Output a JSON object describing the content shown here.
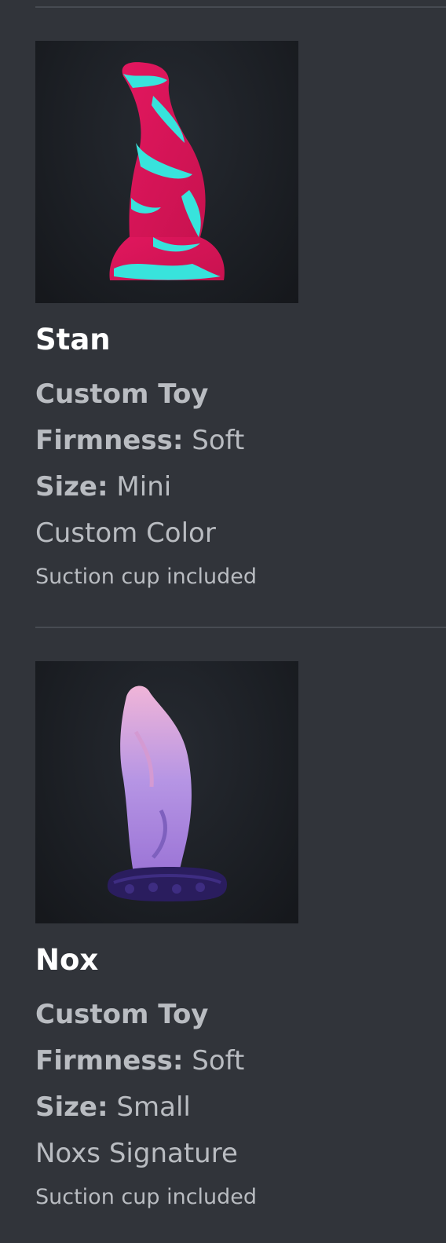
{
  "products": [
    {
      "name": "Stan",
      "type": "Custom Toy",
      "firmness_label": "Firmness:",
      "firmness": "Soft",
      "size_label": "Size:",
      "size": "Mini",
      "color": "Custom Color",
      "extra": "Suction cup included",
      "image_colors": [
        "#e3175f",
        "#38e3dc"
      ]
    },
    {
      "name": "Nox",
      "type": "Custom Toy",
      "firmness_label": "Firmness:",
      "firmness": "Soft",
      "size_label": "Size:",
      "size": "Small",
      "color": "Noxs Signature",
      "extra": "Suction cup included",
      "image_colors": [
        "#e8a6d6",
        "#8f6fd3",
        "#2a1d5e"
      ]
    }
  ]
}
